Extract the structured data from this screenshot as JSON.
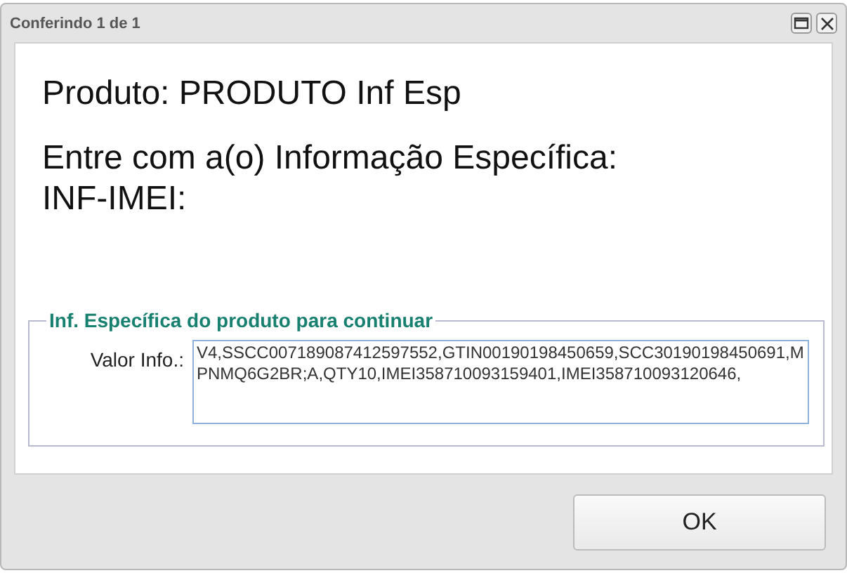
{
  "window": {
    "title": "Conferindo 1 de 1"
  },
  "message": {
    "product_line": "Produto: PRODUTO Inf Esp",
    "prompt_lines": [
      "Entre com a(o) Informação Específica:",
      "INF-IMEI:"
    ]
  },
  "group": {
    "legend": "Inf. Específica do produto para continuar",
    "field_label": "Valor Info.:",
    "value": "V4,SSCC007189087412597552,GTIN00190198450659,SCC30190198450691,MPNMQ6G2BR;A,QTY10,IMEI358710093159401,IMEI358710093120646,"
  },
  "buttons": [
    "OK"
  ]
}
